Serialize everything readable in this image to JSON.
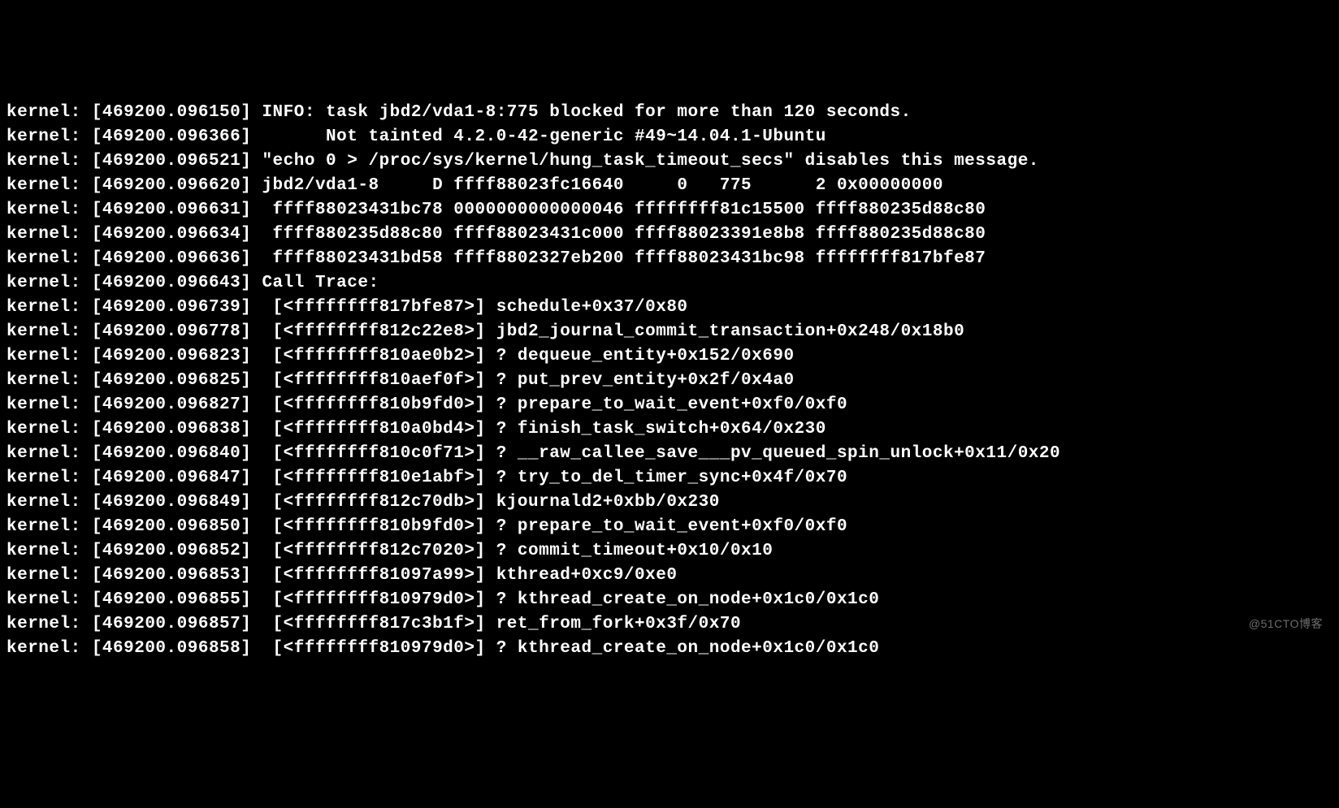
{
  "lines": [
    {
      "prefix": "kernel:",
      "timestamp": "[469200.096150]",
      "content": "INFO: task jbd2/vda1-8:775 blocked for more than 120 seconds."
    },
    {
      "prefix": "kernel:",
      "timestamp": "[469200.096366]",
      "content": "      Not tainted 4.2.0-42-generic #49~14.04.1-Ubuntu"
    },
    {
      "prefix": "kernel:",
      "timestamp": "[469200.096521]",
      "content": "\"echo 0 > /proc/sys/kernel/hung_task_timeout_secs\" disables this message."
    },
    {
      "prefix": "kernel:",
      "timestamp": "[469200.096620]",
      "content": "jbd2/vda1-8     D ffff88023fc16640     0   775      2 0x00000000"
    },
    {
      "prefix": "kernel:",
      "timestamp": "[469200.096631]",
      "content": " ffff88023431bc78 0000000000000046 ffffffff81c15500 ffff880235d88c80"
    },
    {
      "prefix": "kernel:",
      "timestamp": "[469200.096634]",
      "content": " ffff880235d88c80 ffff88023431c000 ffff88023391e8b8 ffff880235d88c80"
    },
    {
      "prefix": "kernel:",
      "timestamp": "[469200.096636]",
      "content": " ffff88023431bd58 ffff8802327eb200 ffff88023431bc98 ffffffff817bfe87"
    },
    {
      "prefix": "kernel:",
      "timestamp": "[469200.096643]",
      "content": "Call Trace:"
    },
    {
      "prefix": "kernel:",
      "timestamp": "[469200.096739]",
      "content": " [<ffffffff817bfe87>] schedule+0x37/0x80"
    },
    {
      "prefix": "kernel:",
      "timestamp": "[469200.096778]",
      "content": " [<ffffffff812c22e8>] jbd2_journal_commit_transaction+0x248/0x18b0"
    },
    {
      "prefix": "kernel:",
      "timestamp": "[469200.096823]",
      "content": " [<ffffffff810ae0b2>] ? dequeue_entity+0x152/0x690"
    },
    {
      "prefix": "kernel:",
      "timestamp": "[469200.096825]",
      "content": " [<ffffffff810aef0f>] ? put_prev_entity+0x2f/0x4a0"
    },
    {
      "prefix": "kernel:",
      "timestamp": "[469200.096827]",
      "content": " [<ffffffff810b9fd0>] ? prepare_to_wait_event+0xf0/0xf0"
    },
    {
      "prefix": "kernel:",
      "timestamp": "[469200.096838]",
      "content": " [<ffffffff810a0bd4>] ? finish_task_switch+0x64/0x230"
    },
    {
      "prefix": "kernel:",
      "timestamp": "[469200.096840]",
      "content": " [<ffffffff810c0f71>] ? __raw_callee_save___pv_queued_spin_unlock+0x11/0x20"
    },
    {
      "prefix": "kernel:",
      "timestamp": "[469200.096847]",
      "content": " [<ffffffff810e1abf>] ? try_to_del_timer_sync+0x4f/0x70"
    },
    {
      "prefix": "kernel:",
      "timestamp": "[469200.096849]",
      "content": " [<ffffffff812c70db>] kjournald2+0xbb/0x230"
    },
    {
      "prefix": "kernel:",
      "timestamp": "[469200.096850]",
      "content": " [<ffffffff810b9fd0>] ? prepare_to_wait_event+0xf0/0xf0"
    },
    {
      "prefix": "kernel:",
      "timestamp": "[469200.096852]",
      "content": " [<ffffffff812c7020>] ? commit_timeout+0x10/0x10"
    },
    {
      "prefix": "kernel:",
      "timestamp": "[469200.096853]",
      "content": " [<ffffffff81097a99>] kthread+0xc9/0xe0"
    },
    {
      "prefix": "kernel:",
      "timestamp": "[469200.096855]",
      "content": " [<ffffffff810979d0>] ? kthread_create_on_node+0x1c0/0x1c0"
    },
    {
      "prefix": "kernel:",
      "timestamp": "[469200.096857]",
      "content": " [<ffffffff817c3b1f>] ret_from_fork+0x3f/0x70"
    },
    {
      "prefix": "kernel:",
      "timestamp": "[469200.096858]",
      "content": " [<ffffffff810979d0>] ? kthread_create_on_node+0x1c0/0x1c0"
    }
  ],
  "watermark": "@51CTO博客"
}
